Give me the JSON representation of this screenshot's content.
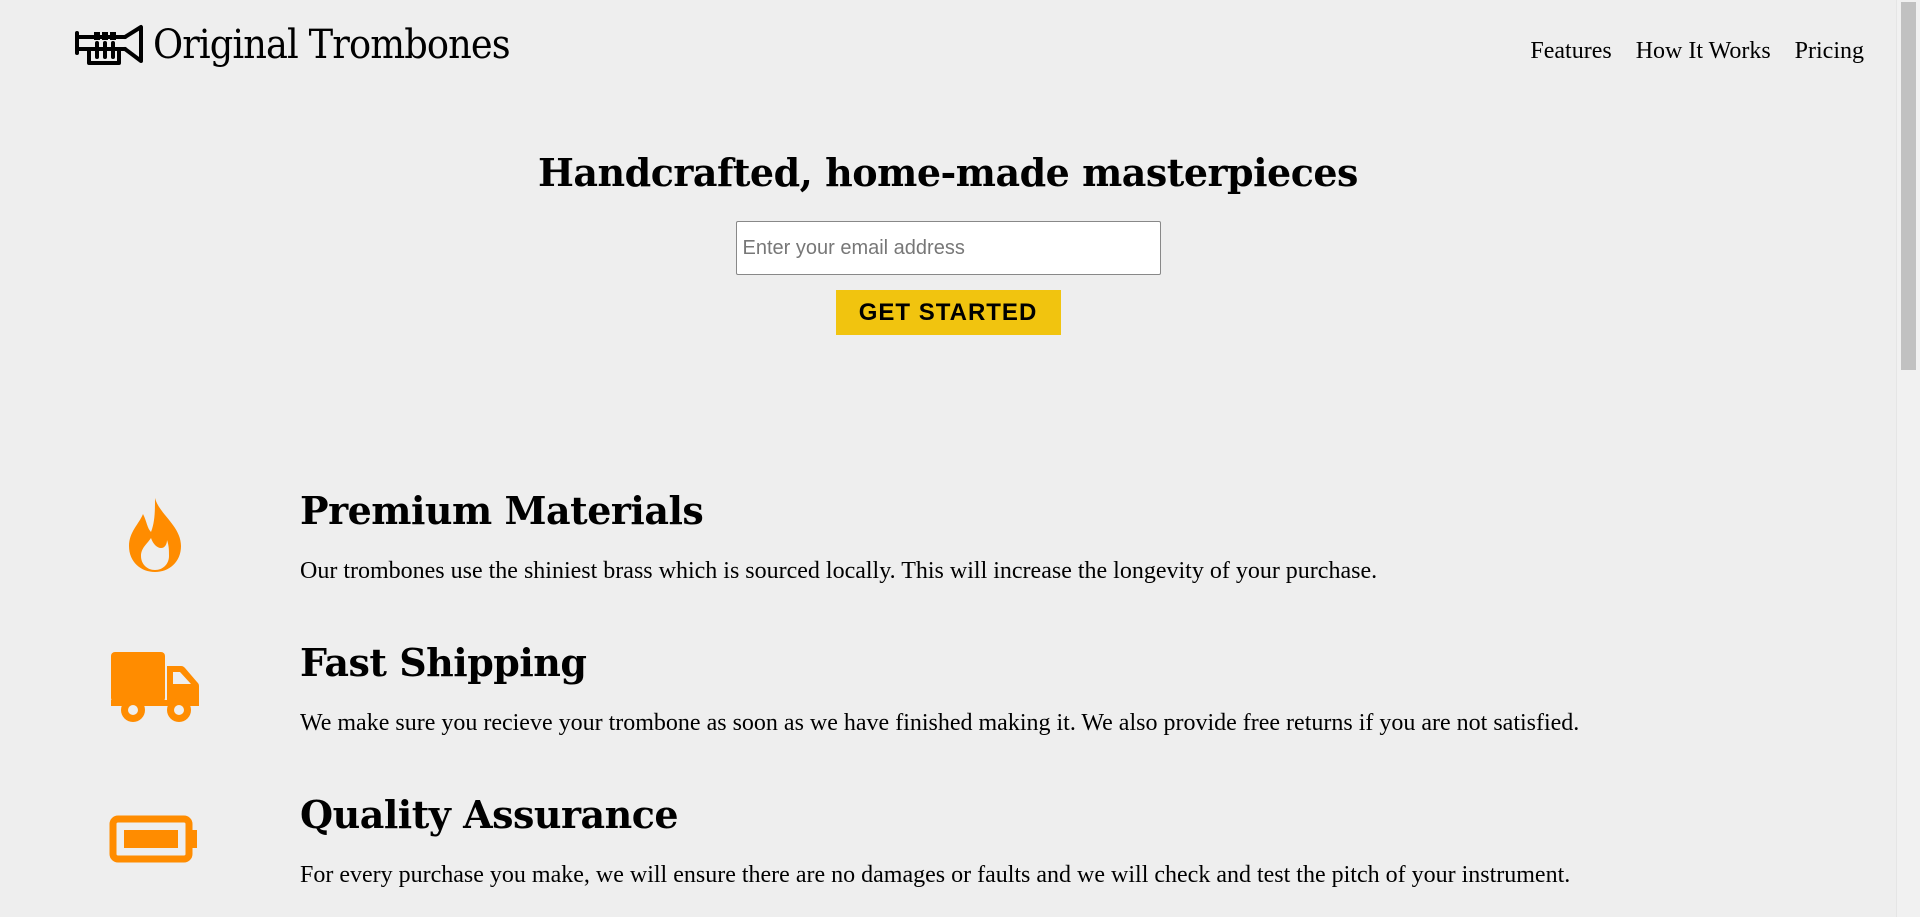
{
  "header": {
    "brand": "Original Trombones",
    "logo_icon": "trumpet-logo-icon",
    "nav": [
      {
        "label": "Features"
      },
      {
        "label": "How It Works"
      },
      {
        "label": "Pricing"
      }
    ]
  },
  "hero": {
    "title": "Handcrafted, home-made masterpieces",
    "email_placeholder": "Enter your email address",
    "email_value": "",
    "cta_label": "GET STARTED"
  },
  "features": [
    {
      "icon": "fire-icon",
      "title": "Premium Materials",
      "description": "Our trombones use the shiniest brass which is sourced locally. This will increase the longevity of your purchase."
    },
    {
      "icon": "truck-icon",
      "title": "Fast Shipping",
      "description": "We make sure you recieve your trombone as soon as we have finished making it. We also provide free returns if you are not satisfied."
    },
    {
      "icon": "battery-icon",
      "title": "Quality Assurance",
      "description": "For every purchase you make, we will ensure there are no damages or faults and we will check and test the pitch of your instrument."
    }
  ],
  "colors": {
    "background": "#eeeeee",
    "accent": "#f1c40f",
    "icon": "#ff8c00"
  }
}
